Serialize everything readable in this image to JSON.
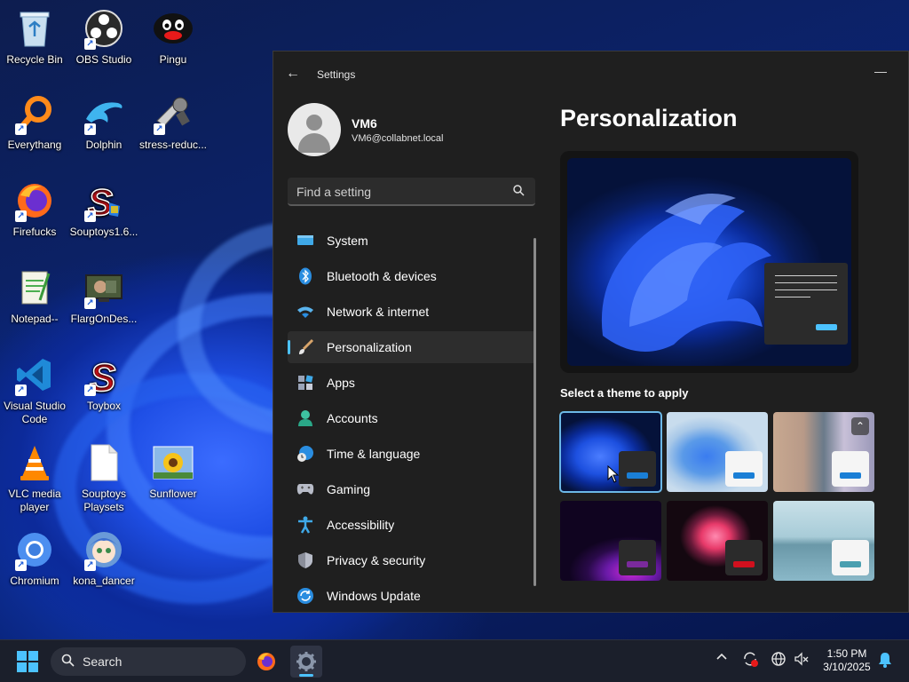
{
  "desktop": {
    "icons": [
      {
        "label": "Recycle Bin",
        "icon": "recycle-bin-icon"
      },
      {
        "label": "OBS Studio",
        "icon": "obs-icon"
      },
      {
        "label": "Pingu",
        "icon": "pingu-icon"
      },
      {
        "label": "Everythang",
        "icon": "search-magnifier-icon"
      },
      {
        "label": "Dolphin",
        "icon": "dolphin-icon"
      },
      {
        "label": "stress-reduc...",
        "icon": "stress-icon"
      },
      {
        "label": "Firefucks",
        "icon": "firefox-icon"
      },
      {
        "label": "Souptoys1.6...",
        "icon": "souptoys-icon"
      },
      {
        "label": "Notepad--",
        "icon": "notepad-icon"
      },
      {
        "label": "FlargOnDes...",
        "icon": "flarg-icon"
      },
      {
        "label": "Visual Studio Code",
        "icon": "vscode-icon"
      },
      {
        "label": "Toybox",
        "icon": "toybox-icon"
      },
      {
        "label": "VLC media player",
        "icon": "vlc-icon"
      },
      {
        "label": "Souptoys Playsets",
        "icon": "document-icon"
      },
      {
        "label": "Sunflower",
        "icon": "sunflower-icon"
      },
      {
        "label": "Chromium",
        "icon": "chromium-icon"
      },
      {
        "label": "kona_dancer",
        "icon": "kona-icon"
      }
    ]
  },
  "settings": {
    "title": "Settings",
    "profile": {
      "name": "VM6",
      "email": "VM6@collabnet.local"
    },
    "search_placeholder": "Find a setting",
    "nav": [
      {
        "label": "System",
        "icon": "system-icon"
      },
      {
        "label": "Bluetooth & devices",
        "icon": "bluetooth-icon"
      },
      {
        "label": "Network & internet",
        "icon": "wifi-icon"
      },
      {
        "label": "Personalization",
        "icon": "brush-icon",
        "active": true
      },
      {
        "label": "Apps",
        "icon": "apps-icon"
      },
      {
        "label": "Accounts",
        "icon": "accounts-icon"
      },
      {
        "label": "Time & language",
        "icon": "clock-globe-icon"
      },
      {
        "label": "Gaming",
        "icon": "gamepad-icon"
      },
      {
        "label": "Accessibility",
        "icon": "accessibility-icon"
      },
      {
        "label": "Privacy & security",
        "icon": "shield-icon"
      },
      {
        "label": "Windows Update",
        "icon": "update-icon"
      }
    ],
    "page_title": "Personalization",
    "theme_section_label": "Select a theme to apply",
    "themes": [
      {
        "name": "windows-dark",
        "selected": true,
        "accent": "#1a7fd6"
      },
      {
        "name": "windows-light",
        "selected": false,
        "accent": "#1a7fd6"
      },
      {
        "name": "glow",
        "selected": false,
        "accent": "#1a7fd6",
        "badge": true
      },
      {
        "name": "captured-motion",
        "selected": false,
        "accent": "#7a2a9c"
      },
      {
        "name": "sunrise",
        "selected": false,
        "accent": "#d1101e"
      },
      {
        "name": "flow",
        "selected": false,
        "accent": "#4a9fb0"
      }
    ]
  },
  "taskbar": {
    "search_label": "Search",
    "clock_time": "1:50 PM",
    "clock_date": "3/10/2025"
  },
  "colors": {
    "accent": "#4cc2ff",
    "window_bg": "#1f1f1f"
  }
}
